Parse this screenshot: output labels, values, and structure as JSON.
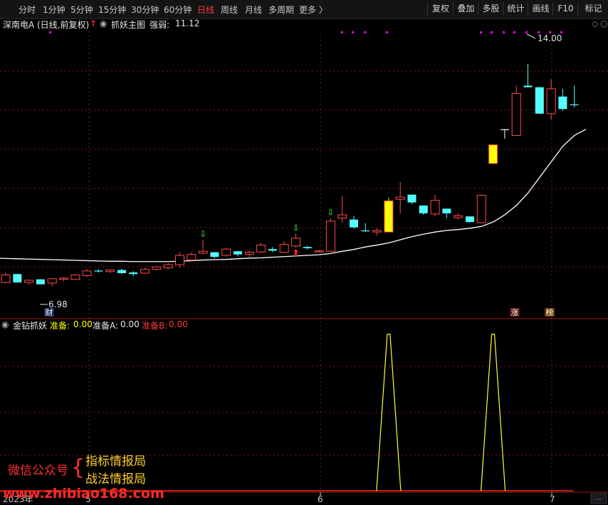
{
  "toolbar": {
    "periods": [
      "分时",
      "1分钟",
      "5分钟",
      "15分钟",
      "30分钟",
      "60分钟",
      "日线",
      "周线",
      "月线",
      "多周期",
      "更多 〉"
    ],
    "active_period": "日线",
    "right_buttons": [
      "复权",
      "叠加",
      "多股",
      "统计",
      "画线",
      "F10",
      "标记"
    ]
  },
  "info": {
    "stock": "深南电A",
    "mode": "(日线,前复权)",
    "indicator": "抓妖主图",
    "strength_label": "强弱:",
    "strength_value": "11.12"
  },
  "lower": {
    "name": "金钻抓妖",
    "ready_label": "准备:",
    "ready_value": "0.00",
    "ready_a_label": "准备A:",
    "ready_a_value": "0.00",
    "ready_b_label": "准备B:",
    "ready_b_value": "0.00"
  },
  "chart_data": {
    "type": "candlestick",
    "price_axis": {
      "ylim": [
        6.0,
        15.0
      ]
    },
    "annotations": {
      "high_label": "14.00",
      "low_label": "6.98",
      "badge_cai": "财",
      "badge_zhang": "涨",
      "badge_bang": "榜"
    },
    "time_axis": {
      "labels": [
        "2023年",
        "5",
        "6",
        "7"
      ]
    },
    "candles": [
      {
        "o": 6.98,
        "h": 7.3,
        "l": 6.95,
        "c": 7.22,
        "color": "red"
      },
      {
        "o": 7.25,
        "h": 7.25,
        "l": 6.98,
        "c": 6.98,
        "color": "cyan"
      },
      {
        "o": 6.98,
        "h": 7.08,
        "l": 6.92,
        "c": 7.05,
        "color": "red"
      },
      {
        "o": 7.08,
        "h": 7.08,
        "l": 6.92,
        "c": 6.92,
        "color": "cyan"
      },
      {
        "o": 6.96,
        "h": 7.12,
        "l": 6.85,
        "c": 7.1,
        "color": "red"
      },
      {
        "o": 7.08,
        "h": 7.15,
        "l": 7.02,
        "c": 7.12,
        "color": "red"
      },
      {
        "o": 7.08,
        "h": 7.25,
        "l": 7.06,
        "c": 7.22,
        "color": "red"
      },
      {
        "o": 7.2,
        "h": 7.4,
        "l": 7.15,
        "c": 7.35,
        "color": "red"
      },
      {
        "o": 7.34,
        "h": 7.4,
        "l": 7.3,
        "c": 7.36,
        "color": "cyan"
      },
      {
        "o": 7.33,
        "h": 7.4,
        "l": 7.28,
        "c": 7.38,
        "color": "red"
      },
      {
        "o": 7.38,
        "h": 7.42,
        "l": 7.25,
        "c": 7.28,
        "color": "cyan"
      },
      {
        "o": 7.3,
        "h": 7.34,
        "l": 7.18,
        "c": 7.25,
        "color": "cyan"
      },
      {
        "o": 7.28,
        "h": 7.45,
        "l": 7.25,
        "c": 7.4,
        "color": "red"
      },
      {
        "o": 7.4,
        "h": 7.5,
        "l": 7.36,
        "c": 7.48,
        "color": "red"
      },
      {
        "o": 7.45,
        "h": 7.6,
        "l": 7.4,
        "c": 7.55,
        "color": "red"
      },
      {
        "o": 7.55,
        "h": 7.95,
        "l": 7.45,
        "c": 7.85,
        "color": "red"
      },
      {
        "o": 7.7,
        "h": 7.95,
        "l": 7.65,
        "c": 7.88,
        "color": "red"
      },
      {
        "o": 7.92,
        "h": 8.35,
        "l": 7.88,
        "c": 7.98,
        "color": "red"
      },
      {
        "o": 7.95,
        "h": 7.95,
        "l": 7.75,
        "c": 7.8,
        "color": "cyan"
      },
      {
        "o": 7.85,
        "h": 8.1,
        "l": 7.8,
        "c": 8.05,
        "color": "red"
      },
      {
        "o": 7.98,
        "h": 8.0,
        "l": 7.82,
        "c": 7.88,
        "color": "cyan"
      },
      {
        "o": 7.88,
        "h": 8.0,
        "l": 7.8,
        "c": 7.95,
        "color": "red"
      },
      {
        "o": 7.96,
        "h": 8.25,
        "l": 7.92,
        "c": 8.18,
        "color": "red"
      },
      {
        "o": 8.05,
        "h": 8.12,
        "l": 7.95,
        "c": 8.0,
        "color": "cyan"
      },
      {
        "o": 7.95,
        "h": 8.3,
        "l": 7.92,
        "c": 8.2,
        "color": "red"
      },
      {
        "o": 8.15,
        "h": 8.55,
        "l": 8.1,
        "c": 8.4,
        "color": "red"
      },
      {
        "o": 8.12,
        "h": 8.16,
        "l": 8.04,
        "c": 8.08,
        "color": "cyan"
      },
      {
        "o": 7.98,
        "h": 8.02,
        "l": 7.95,
        "c": 7.99,
        "color": "red"
      },
      {
        "o": 7.98,
        "h": 9.05,
        "l": 7.96,
        "c": 8.95,
        "color": "red"
      },
      {
        "o": 9.05,
        "h": 9.75,
        "l": 8.9,
        "c": 9.15,
        "color": "red"
      },
      {
        "o": 9.0,
        "h": 9.12,
        "l": 8.7,
        "c": 8.75,
        "color": "cyan"
      },
      {
        "o": 8.65,
        "h": 8.88,
        "l": 8.6,
        "c": 8.65,
        "color": "cyan"
      },
      {
        "o": 8.6,
        "h": 8.72,
        "l": 8.48,
        "c": 8.65,
        "color": "red"
      },
      {
        "o": 8.6,
        "h": 9.7,
        "l": 8.6,
        "c": 9.6,
        "color": "yellow"
      },
      {
        "o": 9.65,
        "h": 10.2,
        "l": 9.2,
        "c": 9.72,
        "color": "red"
      },
      {
        "o": 9.8,
        "h": 9.8,
        "l": 9.5,
        "c": 9.55,
        "color": "cyan"
      },
      {
        "o": 9.45,
        "h": 9.45,
        "l": 9.15,
        "c": 9.2,
        "color": "cyan"
      },
      {
        "o": 9.18,
        "h": 9.8,
        "l": 9.1,
        "c": 9.62,
        "color": "red"
      },
      {
        "o": 9.35,
        "h": 9.35,
        "l": 9.05,
        "c": 9.2,
        "color": "cyan"
      },
      {
        "o": 9.06,
        "h": 9.2,
        "l": 9.0,
        "c": 9.12,
        "color": "red"
      },
      {
        "o": 9.1,
        "h": 9.1,
        "l": 8.9,
        "c": 8.92,
        "color": "cyan"
      },
      {
        "o": 8.9,
        "h": 9.8,
        "l": 8.88,
        "c": 9.78,
        "color": "red"
      },
      {
        "o": 10.8,
        "h": 11.4,
        "l": 10.78,
        "c": 11.4,
        "color": "yellow"
      },
      {
        "o": 11.9,
        "h": 11.9,
        "l": 11.6,
        "c": 11.9,
        "color": "white"
      },
      {
        "o": 11.7,
        "h": 13.3,
        "l": 11.7,
        "c": 13.05,
        "color": "red"
      },
      {
        "o": 13.3,
        "h": 14.0,
        "l": 13.25,
        "c": 13.25,
        "color": "cyan"
      },
      {
        "o": 13.25,
        "h": 13.25,
        "l": 12.4,
        "c": 12.4,
        "color": "cyan"
      },
      {
        "o": 12.4,
        "h": 13.5,
        "l": 12.2,
        "c": 13.2,
        "color": "red"
      },
      {
        "o": 12.95,
        "h": 13.2,
        "l": 12.5,
        "c": 12.55,
        "color": "cyan"
      },
      {
        "o": 12.7,
        "h": 13.3,
        "l": 12.6,
        "c": 12.7,
        "color": "cyan"
      }
    ],
    "ma_line": [
      7.75,
      7.74,
      7.73,
      7.72,
      7.71,
      7.7,
      7.69,
      7.68,
      7.67,
      7.66,
      7.66,
      7.65,
      7.65,
      7.65,
      7.65,
      7.66,
      7.68,
      7.7,
      7.71,
      7.72,
      7.74,
      7.76,
      7.77,
      7.79,
      7.81,
      7.83,
      7.85,
      7.87,
      7.91,
      7.98,
      8.04,
      8.12,
      8.18,
      8.25,
      8.35,
      8.45,
      8.53,
      8.6,
      8.65,
      8.68,
      8.72,
      8.78,
      8.92,
      9.15,
      9.45,
      9.85,
      10.35,
      10.85,
      11.35,
      11.7,
      11.9
    ],
    "signal_series": {
      "name": "准备",
      "peaks": [
        {
          "candle": 33,
          "value": 1
        },
        {
          "candle": 42,
          "value": 1
        }
      ]
    }
  },
  "watermark": {
    "prefix": "微信公众号",
    "line1": "指标情报局",
    "line2": "战法情报局",
    "url": "www.zhibiao168.com"
  },
  "colors": {
    "up": "#ff4a4a",
    "down": "#54ffff",
    "yellow": "#ffff00",
    "ma": "#ffffff",
    "grid": "#7a1a1a",
    "magenta": "#ff00ff"
  }
}
